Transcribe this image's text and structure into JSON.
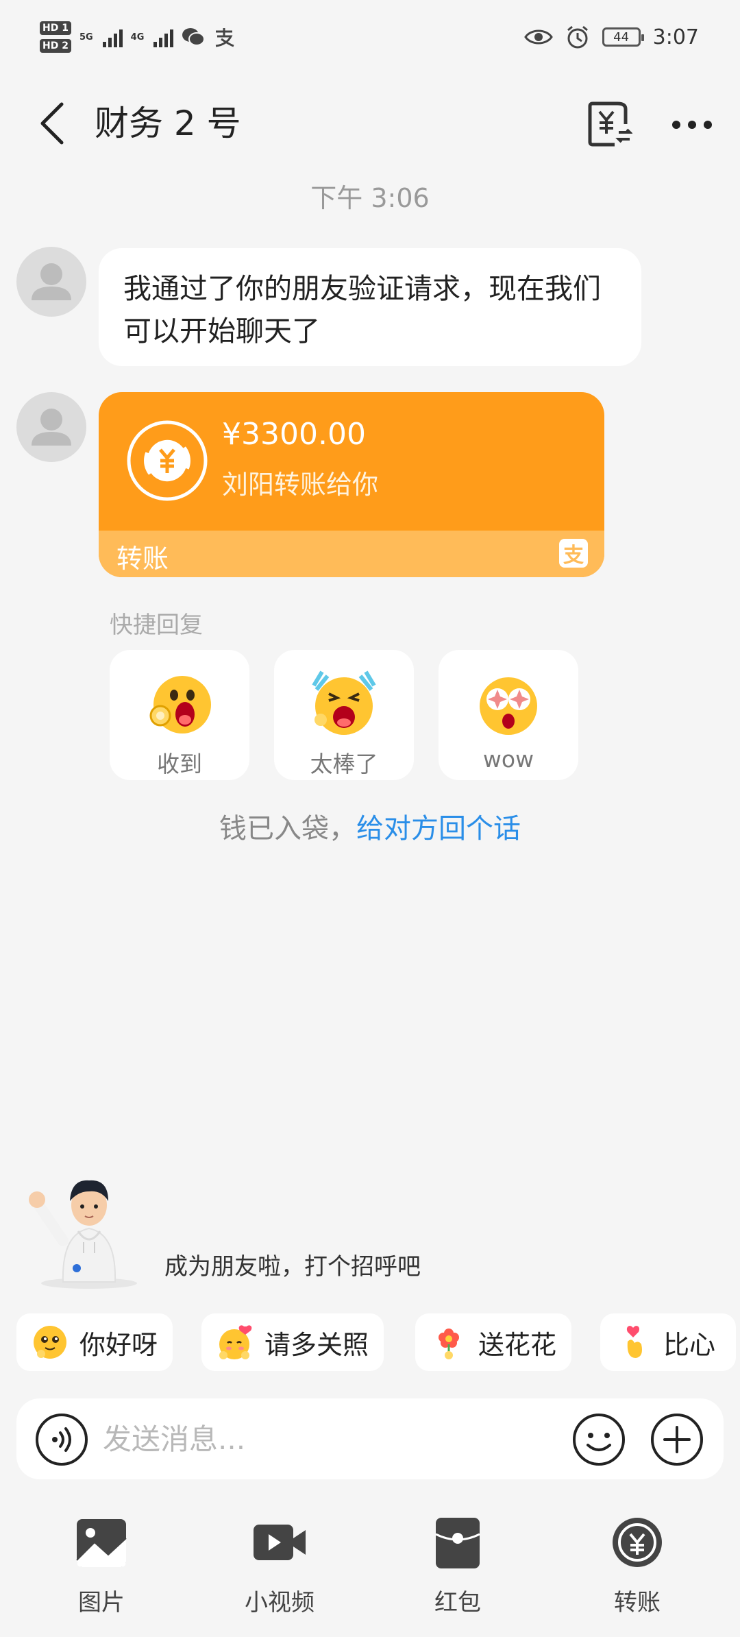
{
  "status_bar": {
    "time": "3:07",
    "battery": "44",
    "hd1": "HD 1",
    "hd2": "HD 2",
    "net1": "5G",
    "net2": "4G"
  },
  "header": {
    "title": "财务 2 号"
  },
  "timestamp": "下午 3:06",
  "messages": {
    "first": "我通过了你的朋友验证请求，现在我们可以开始聊天了",
    "transfer": {
      "amount": "¥3300.00",
      "description": "刘阳转账给你",
      "type_label": "转账",
      "brand_glyph": "支"
    }
  },
  "quick_reply": {
    "label": "快捷回复",
    "items": [
      {
        "label": "收到",
        "icon": "ok-hand-emoji-icon"
      },
      {
        "label": "太棒了",
        "icon": "cheering-emoji-icon"
      },
      {
        "label": "wow",
        "icon": "wow-emoji-icon"
      }
    ]
  },
  "hint": {
    "prefix": "钱已入袋，",
    "link": "给对方回个话"
  },
  "greeting": {
    "text": "成为朋友啦，打个招呼吧"
  },
  "chips": [
    {
      "label": "你好呀",
      "icon": "smile-emoji-icon"
    },
    {
      "label": "请多关照",
      "icon": "hug-heart-emoji-icon"
    },
    {
      "label": "送花花",
      "icon": "flower-icon"
    },
    {
      "label": "比心",
      "icon": "finger-heart-icon"
    }
  ],
  "input": {
    "placeholder": "发送消息..."
  },
  "toolbar": {
    "photo": "图片",
    "video": "小视频",
    "red_packet": "红包",
    "transfer": "转账"
  },
  "colors": {
    "transfer_orange": "#ff9c1a",
    "transfer_orange_light": "#ffbb58",
    "link_blue": "#2a8ee8",
    "background": "#f5f5f5"
  }
}
